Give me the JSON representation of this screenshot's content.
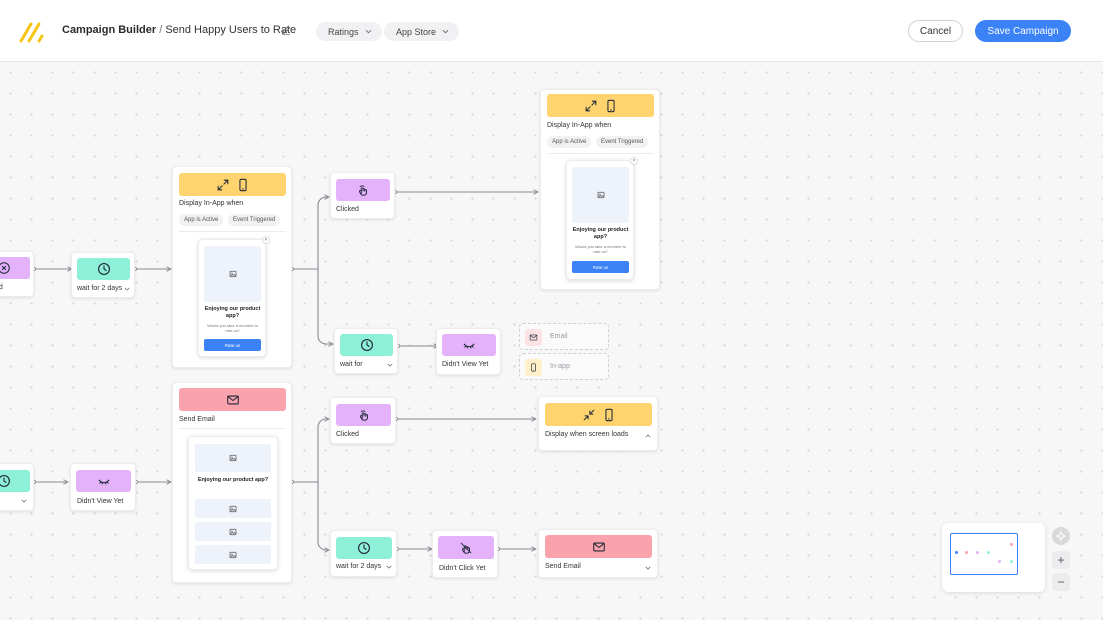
{
  "header": {
    "app_name": "Campaign Builder",
    "separator": "/",
    "campaign_name": "Send Happy Users to Rate",
    "filters": [
      {
        "label": "Ratings"
      },
      {
        "label": "App Store"
      }
    ],
    "cancel_label": "Cancel",
    "save_label": "Save Campaign"
  },
  "canvas": {
    "nodes": {
      "left_top_partial": {
        "label": "ed"
      },
      "wait_top": {
        "label": "wait for 2 days"
      },
      "display_inapp_1": {
        "header_label": "Display In-App when",
        "tags": [
          "App is Active",
          "Event Triggered"
        ],
        "preview": {
          "title": "Enjoying our product app?",
          "subtitle": "Would you take a moment to rate us?",
          "button": "Rate us",
          "close": "×"
        }
      },
      "clicked_top": {
        "label": "Clicked"
      },
      "display_inapp_2": {
        "header_label": "Display In-App when",
        "tags": [
          "App is Active",
          "Event Triggered"
        ],
        "preview": {
          "title": "Enjoying our product app?",
          "subtitle": "Would you take a moment to rate us?",
          "button": "Rate us",
          "close": "×"
        }
      },
      "wait_mid": {
        "label": "wait for"
      },
      "didnt_view_mid": {
        "label": "Didn't View Yet"
      },
      "ghost_email": {
        "label": "Email"
      },
      "ghost_inapp": {
        "label": "In-app"
      },
      "send_email_1": {
        "header_label": "Send Email",
        "preview": {
          "title": "Enjoying our product app?"
        }
      },
      "clicked_bottom": {
        "label": "Clicked"
      },
      "display_screen_loads": {
        "label": "Display when screen loads"
      },
      "didnt_view_left": {
        "label": "Didn't View Yet"
      },
      "wait_bottom": {
        "label": "wait for 2 days"
      },
      "didnt_click": {
        "label": "Didn't Click Yet"
      },
      "send_email_2": {
        "label": "Send Email"
      }
    }
  },
  "zoom_controls": {
    "zoom_in": "+",
    "zoom_out": "−"
  },
  "colors": {
    "accent": "#3b82f6",
    "purple": "#e4b2fb",
    "mint": "#8ff0d8",
    "yellow": "#ffd36e",
    "pink": "#fba3ad",
    "logo": "#f5c518"
  },
  "icons": {
    "logo": "double-slash-logo",
    "edit": "pencil-icon",
    "clock": "clock-icon",
    "clicked": "hand-tap-icon",
    "didnt_view": "closed-eye-icon",
    "didnt_click": "hand-tap-slash-icon",
    "expand": "expand-arrows-icon",
    "collapse": "collapse-arrows-icon",
    "phone": "phone-icon",
    "email": "envelope-icon",
    "image": "image-icon"
  }
}
